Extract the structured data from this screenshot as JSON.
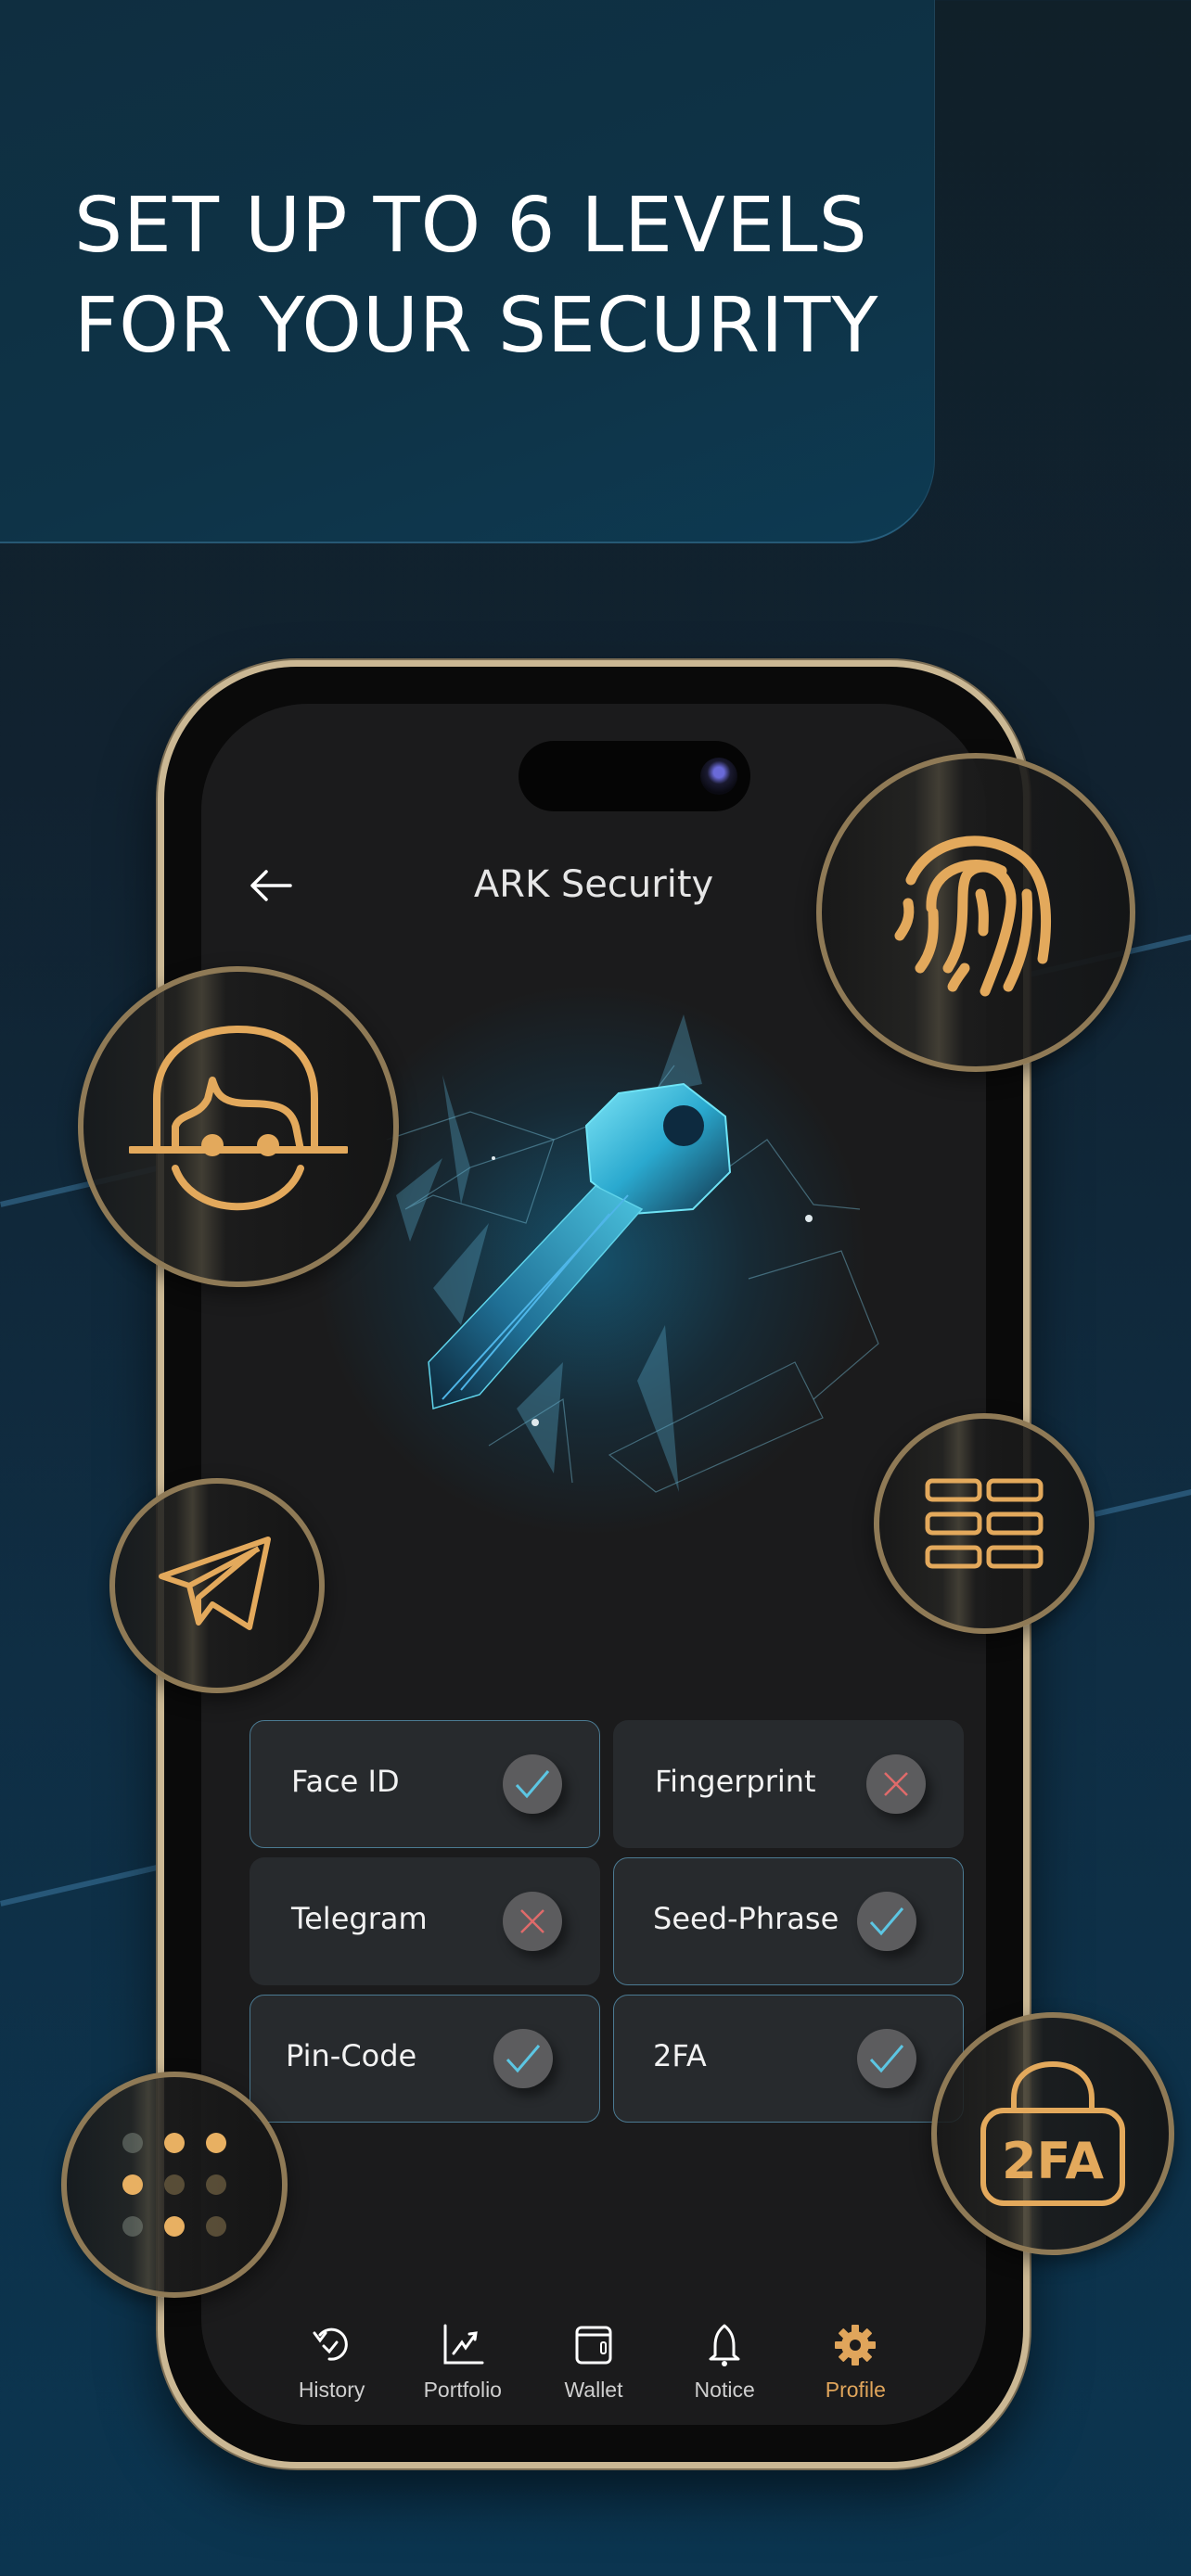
{
  "hero": {
    "line1": "SET UP TO 6 LEVELS",
    "line2": "FOR YOUR SECURITY"
  },
  "screen": {
    "title": "ARK Security",
    "back_icon": "arrow-left-icon"
  },
  "colors": {
    "accent_gold": "#e0a55b",
    "check_blue": "#5cc6e3",
    "cross_red": "#e06a6a",
    "card_bg": "#272a2d",
    "screen_bg": "#1b1b1c",
    "active_border": "#4b7a92"
  },
  "options": [
    {
      "label": "Face ID",
      "status": "enabled",
      "status_icon": "check-icon"
    },
    {
      "label": "Fingerprint",
      "status": "disabled",
      "status_icon": "cross-icon"
    },
    {
      "label": "Telegram",
      "status": "disabled",
      "status_icon": "cross-icon"
    },
    {
      "label": "Seed-Phrase",
      "status": "enabled",
      "status_icon": "check-icon"
    },
    {
      "label": "Pin-Code",
      "status": "enabled",
      "status_icon": "check-icon"
    },
    {
      "label": "2FA",
      "status": "enabled",
      "status_icon": "check-icon"
    }
  ],
  "tabs": [
    {
      "label": "History",
      "icon": "history-icon",
      "active": false
    },
    {
      "label": "Portfolio",
      "icon": "chart-icon",
      "active": false
    },
    {
      "label": "Wallet",
      "icon": "wallet-icon",
      "active": false
    },
    {
      "label": "Notice",
      "icon": "bell-icon",
      "active": false
    },
    {
      "label": "Profile",
      "icon": "gear-icon",
      "active": true
    }
  ],
  "badges": {
    "fingerprint": "fingerprint-icon",
    "face": "face-id-icon",
    "telegram": "telegram-icon",
    "seed": "seed-phrase-icon",
    "pin": "pin-code-icon",
    "twofa": {
      "icon": "lock-2fa-icon",
      "text": "2FA"
    }
  }
}
